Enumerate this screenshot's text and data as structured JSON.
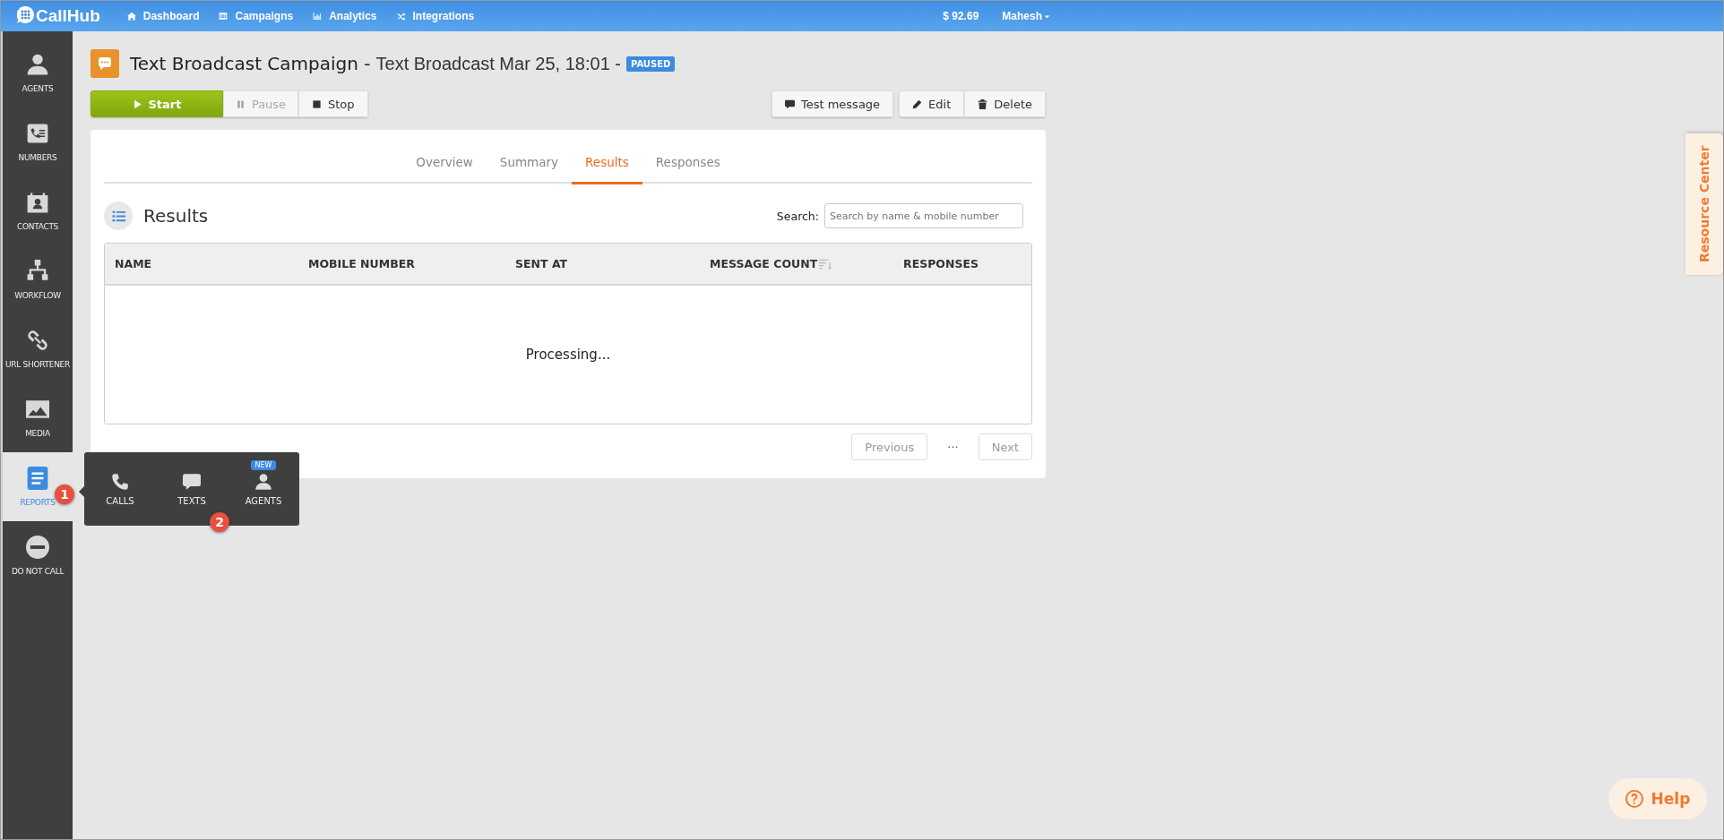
{
  "top_bar": {
    "logo": "CallHub",
    "nav": [
      {
        "label": "Dashboard",
        "kind": "home"
      },
      {
        "label": "Campaigns",
        "kind": "table"
      },
      {
        "label": "Analytics",
        "kind": "chart"
      },
      {
        "label": "Integrations",
        "kind": "shuffle"
      }
    ],
    "balance": "$ 92.69",
    "user": "Mahesh"
  },
  "sidebar": {
    "items": [
      {
        "label": "AGENTS",
        "kind": "person",
        "selected": false
      },
      {
        "label": "NUMBERS",
        "kind": "numbers",
        "selected": false
      },
      {
        "label": "CONTACTS",
        "kind": "contacts",
        "selected": false
      },
      {
        "label": "WORKFLOW",
        "kind": "workflow",
        "selected": false
      },
      {
        "label": "URL SHORTENER",
        "kind": "link",
        "selected": false
      },
      {
        "label": "MEDIA",
        "kind": "image",
        "selected": false
      },
      {
        "label": "REPORTS",
        "kind": "document",
        "selected": true,
        "marker": "1"
      },
      {
        "label": "DO NOT CALL",
        "kind": "minus",
        "selected": false
      }
    ]
  },
  "reports_menu": {
    "items": [
      {
        "label": "CALLS",
        "kind": "phone"
      },
      {
        "label": "TEXTS",
        "kind": "chat",
        "marker": "2"
      },
      {
        "label": "AGENTS",
        "kind": "person",
        "badge": "NEW"
      }
    ]
  },
  "campaign": {
    "title": "Text Broadcast Campaign -",
    "subtitle": "Text Broadcast Mar 25, 18:01 -",
    "status": "PAUSED"
  },
  "controls": [
    {
      "label": "Start",
      "kind": "start",
      "disabled": false
    },
    {
      "label": "Pause",
      "kind": "pause",
      "disabled": true
    },
    {
      "label": "Stop",
      "kind": "stop",
      "disabled": false
    }
  ],
  "actions": [
    {
      "label": "Test message",
      "kind": "chat",
      "group_start": true
    },
    {
      "label": "Edit",
      "kind": "pencil",
      "group_start": true
    },
    {
      "label": "Delete",
      "kind": "trash",
      "group_start": false
    }
  ],
  "tabs": [
    {
      "label": "Overview",
      "selected": false
    },
    {
      "label": "Summary",
      "selected": false
    },
    {
      "label": "Results",
      "selected": true
    },
    {
      "label": "Responses",
      "selected": false
    }
  ],
  "results": {
    "title": "Results",
    "search_label": "Search:",
    "search_placeholder": "Search by name & mobile number",
    "columns": [
      {
        "label": "NAME",
        "sortable": false
      },
      {
        "label": "MOBILE NUMBER",
        "sortable": false
      },
      {
        "label": "SENT AT",
        "sortable": false
      },
      {
        "label": "MESSAGE COUNT",
        "sortable": true
      },
      {
        "label": "RESPONSES",
        "sortable": false
      }
    ],
    "empty_text": "Processing...",
    "pagination": {
      "previous": "Previous",
      "ellipsis": "···",
      "next": "Next",
      "disabled": true
    }
  },
  "resource_center": "Resource Center",
  "help": "Help"
}
